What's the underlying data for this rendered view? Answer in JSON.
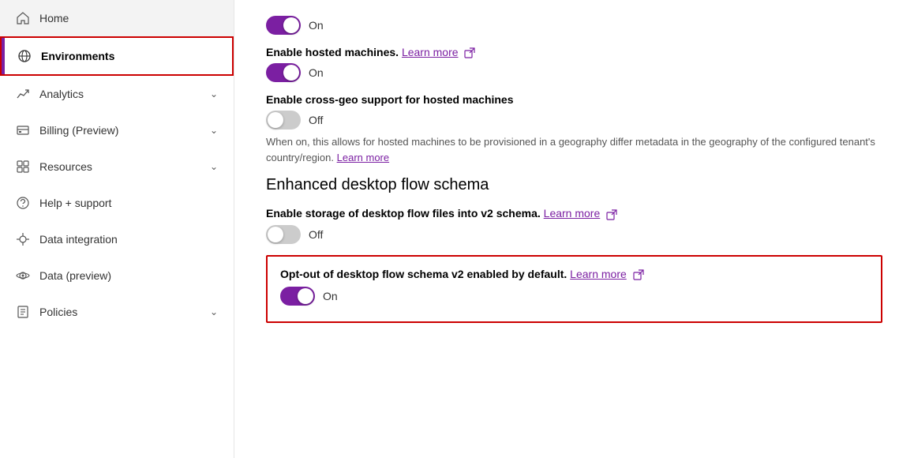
{
  "sidebar": {
    "items": [
      {
        "id": "home",
        "label": "Home",
        "icon": "home",
        "hasChevron": false,
        "active": false
      },
      {
        "id": "environments",
        "label": "Environments",
        "icon": "globe",
        "hasChevron": false,
        "active": true
      },
      {
        "id": "analytics",
        "label": "Analytics",
        "icon": "analytics",
        "hasChevron": true,
        "active": false
      },
      {
        "id": "billing",
        "label": "Billing (Preview)",
        "icon": "billing",
        "hasChevron": true,
        "active": false
      },
      {
        "id": "resources",
        "label": "Resources",
        "icon": "resources",
        "hasChevron": true,
        "active": false
      },
      {
        "id": "help-support",
        "label": "Help + support",
        "icon": "help",
        "hasChevron": false,
        "active": false
      },
      {
        "id": "data-integration",
        "label": "Data integration",
        "icon": "data-integration",
        "hasChevron": false,
        "active": false
      },
      {
        "id": "data-preview",
        "label": "Data (preview)",
        "icon": "data-preview",
        "hasChevron": false,
        "active": false
      },
      {
        "id": "policies",
        "label": "Policies",
        "icon": "policies",
        "hasChevron": true,
        "active": false
      }
    ]
  },
  "main": {
    "settings": [
      {
        "id": "toggle-on-top",
        "label": "",
        "toggleOn": true,
        "toggleText": "On",
        "showLabel": false
      },
      {
        "id": "hosted-machines",
        "label": "Enable hosted machines.",
        "learnMore": "Learn more",
        "toggleOn": true,
        "toggleText": "On"
      },
      {
        "id": "cross-geo",
        "label": "Enable cross-geo support for hosted machines",
        "learnMore": "",
        "toggleOn": false,
        "toggleText": "Off",
        "description": "When on, this allows for hosted machines to be provisioned in a geography differ metadata in the geography of the configured tenant's country/region.",
        "descriptionLearnMore": "Learn more"
      }
    ],
    "section": {
      "heading": "Enhanced desktop flow schema",
      "settings": [
        {
          "id": "desktop-flow-storage",
          "label": "Enable storage of desktop flow files into v2 schema.",
          "learnMore": "Learn more",
          "toggleOn": false,
          "toggleText": "Off"
        },
        {
          "id": "opt-out-desktop-flow",
          "label": "Opt-out of desktop flow schema v2 enabled by default.",
          "learnMore": "Learn more",
          "toggleOn": true,
          "toggleText": "On",
          "highlighted": true
        }
      ]
    }
  }
}
